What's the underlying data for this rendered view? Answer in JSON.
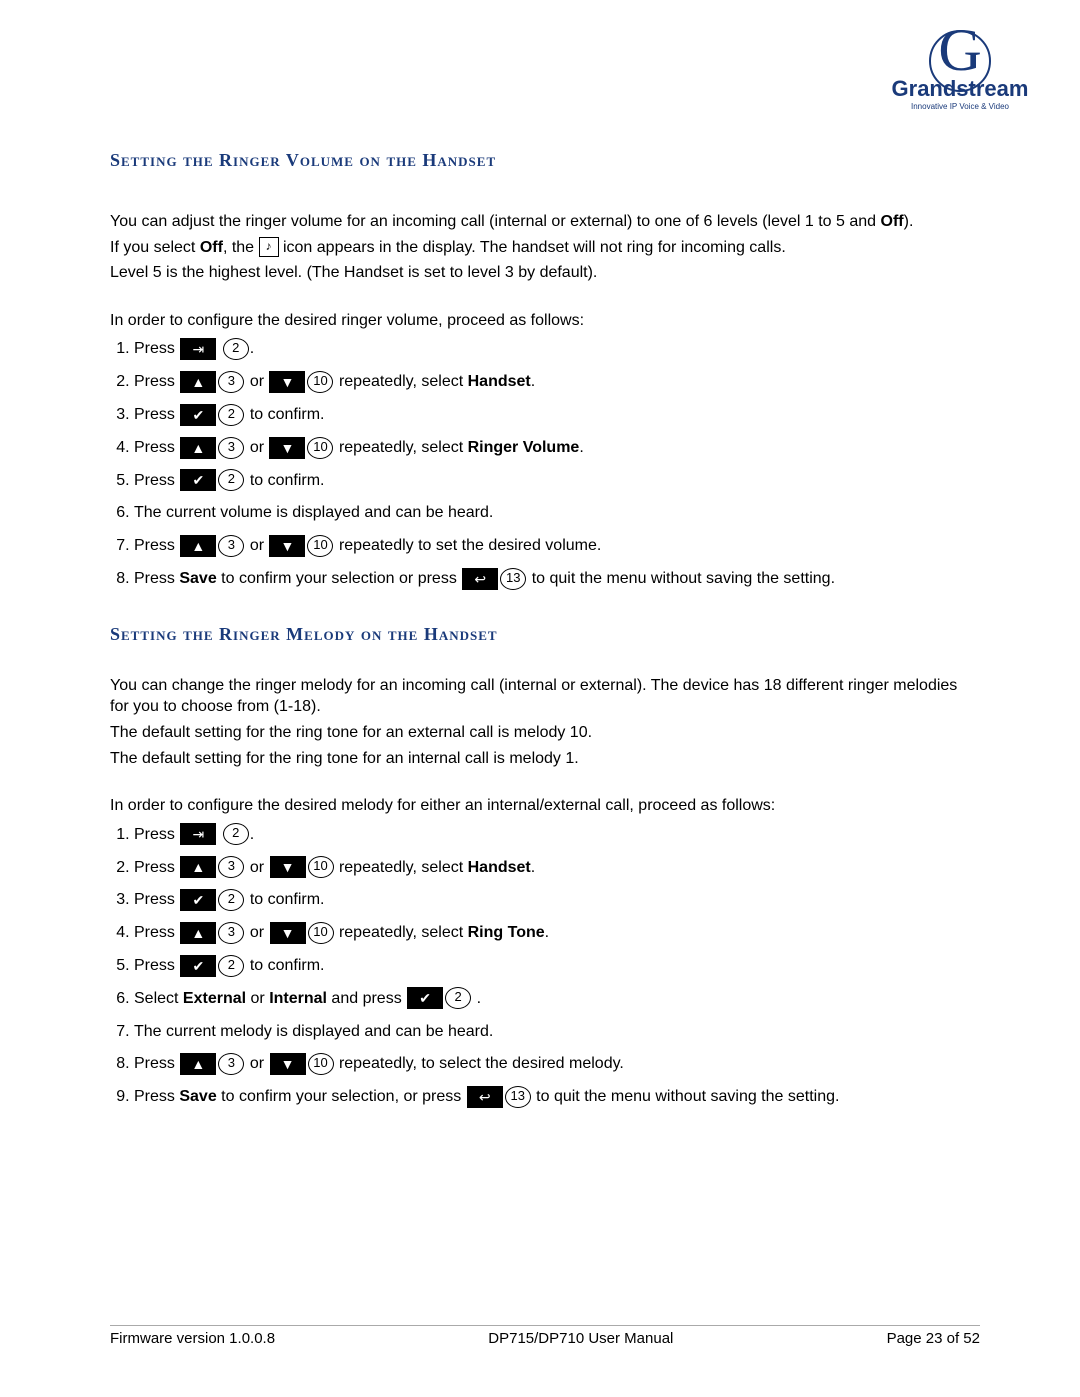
{
  "logo": {
    "brand": "Grandstream",
    "tagline": "Innovative IP Voice & Video"
  },
  "section1": {
    "heading": "Setting the Ringer Volume on the Handset",
    "intro_p1a": "You can adjust the ringer volume for an incoming call (internal or external) to one of 6 levels (level 1 to 5 and ",
    "intro_p1b": "Off",
    "intro_p1c": ").",
    "intro_p2a": "If you select ",
    "intro_p2b": "Off",
    "intro_p2c": ", the ",
    "intro_p2d": " icon appears in the display. The handset will not ring for incoming calls.",
    "intro_p3": "Level 5 is the highest level. (The  Handset is set to level 3 by default).",
    "intro_p4": "In order to configure the desired ringer volume, proceed as follows:",
    "steps": {
      "s1": "Press ",
      "s2a": "Press",
      "s2b": " or ",
      "s2c": "   repeatedly, select ",
      "s2d": "Handset",
      "s2e": ".",
      "s3a": "Press",
      "s3b": " to confirm.",
      "s4a": "Press",
      "s4b": " or ",
      "s4c": "  repeatedly, select ",
      "s4d": "Ringer Volume",
      "s4e": ".",
      "s5a": "Press",
      "s5b": " to confirm.",
      "s6": "The current volume is displayed and can be heard.",
      "s7a": "Press",
      "s7b": " or ",
      "s7c": " repeatedly to set the desired volume.",
      "s8a": "Press ",
      "s8b": "Save",
      "s8c": " to confirm your selection or press   ",
      "s8d": " to quit the menu without saving the setting."
    }
  },
  "section2": {
    "heading": "Setting the Ringer Melody on the Handset",
    "intro_p1": "You can change the ringer melody for an incoming call (internal or external). The device has 18 different ringer melodies for you to choose from (1-18).",
    "intro_p2": "The default setting for the ring tone for an external call is melody 10.",
    "intro_p3": "The default setting for the ring tone for an internal call is melody 1.",
    "intro_p4": "In order to configure the desired melody for either an internal/external call, proceed as follows:",
    "steps": {
      "s1": "Press  ",
      "s2a": "Press",
      "s2b": "  or",
      "s2c": "  repeatedly, select ",
      "s2d": "Handset",
      "s2e": ".",
      "s3a": "Press",
      "s3b": "  to confirm.",
      "s4a": "Press",
      "s4b": "  or",
      "s4c": "  repeatedly, select ",
      "s4d": "Ring Tone",
      "s4e": ".",
      "s5a": "Press",
      "s5b": "  to confirm.",
      "s6a": "Select ",
      "s6b": "External",
      "s6c": " or ",
      "s6d": "Internal",
      "s6e": " and press   ",
      "s6f": " .",
      "s7": "The current melody is displayed and can be heard.",
      "s8a": "Press",
      "s8b": "  or",
      "s8c": "  repeatedly, to select the desired melody.",
      "s9a": "Press ",
      "s9b": "Save",
      "s9c": " to confirm your selection, or press   ",
      "s9d": " to quit the menu without saving the setting."
    }
  },
  "keys": {
    "menu": "⇥",
    "num2": "2",
    "up": "▲",
    "num3": "3",
    "down": "▼",
    "num10": "10",
    "check": "✔",
    "back": "↩",
    "num13": "13",
    "mute": "♪"
  },
  "footer": {
    "left": "Firmware version 1.0.0.8",
    "center": "DP715/DP710 User Manual",
    "right": "Page 23 of 52"
  }
}
